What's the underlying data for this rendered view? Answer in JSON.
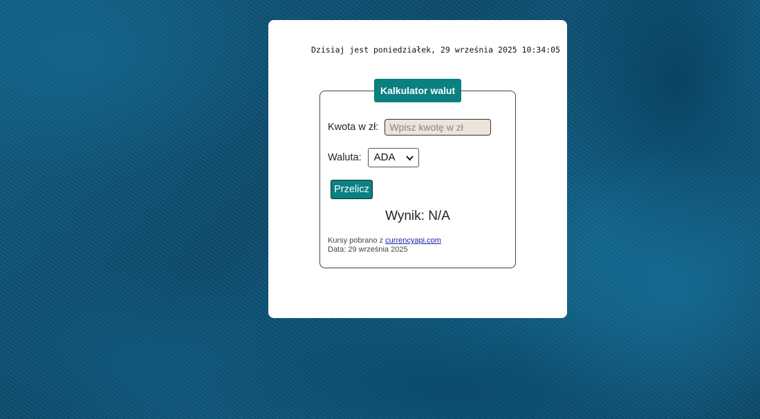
{
  "clock": {
    "text": "Dzisiaj jest poniedziałek, 29 września 2025 10:34:05"
  },
  "calculator": {
    "title": "Kalkulator walut",
    "amount_label": "Kwota w zł:",
    "amount_value": "",
    "amount_placeholder": "Wpisz kwotę w zł",
    "currency_label": "Waluta:",
    "currency_selected": "ADA",
    "convert_button": "Przelicz",
    "result": "Wynik: N/A",
    "source_prefix": "Kursy pobrano z",
    "source_link": "currencyapi.com",
    "date_text": "Data: 29 września 2025"
  },
  "icons": {
    "select_chevron": "chevron-down-icon"
  },
  "colors": {
    "accent": "#0a8080",
    "input_bg": "#ebe4da",
    "link": "#1a1aa6",
    "background": "#0a5478"
  }
}
